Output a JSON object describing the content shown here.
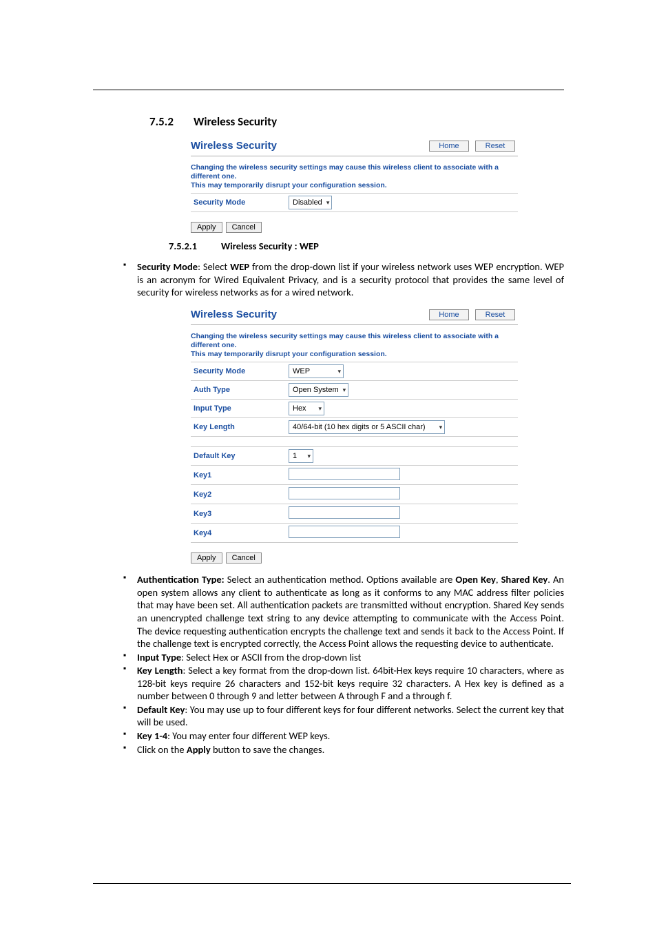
{
  "headings": {
    "section_num": "7.5.2",
    "section_title": "Wireless Security",
    "sub_num": "7.5.2.1",
    "sub_title": "Wireless Security : WEP"
  },
  "panel_common": {
    "title": "Wireless Security",
    "home_btn": "Home",
    "reset_btn": "Reset",
    "note_line1": "Changing the wireless security settings may cause this wireless client to associate with a different one.",
    "note_line2": "This may temporarily disrupt your configuration session.",
    "security_mode_label": "Security Mode",
    "apply_btn": "Apply",
    "cancel_btn": "Cancel"
  },
  "panel1": {
    "security_mode_value": "Disabled"
  },
  "panel2": {
    "security_mode_value": "WEP",
    "auth_type_label": "Auth Type",
    "auth_type_value": "Open System",
    "input_type_label": "Input Type",
    "input_type_value": "Hex",
    "key_length_label": "Key Length",
    "key_length_value": "40/64-bit (10 hex digits or 5 ASCII char)",
    "default_key_label": "Default Key",
    "default_key_value": "1",
    "key1_label": "Key1",
    "key2_label": "Key2",
    "key3_label": "Key3",
    "key4_label": "Key4"
  },
  "paragraphs": {
    "sec_mode": {
      "label": "Security Mode",
      "text_before": ": Select ",
      "bold2": "WEP",
      "text_after": " from the drop-down list if your wireless network uses WEP encryption. WEP is an acronym for Wired Equivalent Privacy, and is a security protocol that provides the same level of security for wireless networks as for a wired network."
    },
    "auth_type": {
      "label": "Authentication Type:",
      "text1": " Select an authentication method. Options available are ",
      "bold2": "Open Key",
      "text2": ", ",
      "bold3": "Shared Key",
      "text3": ". An open system allows any client to authenticate as long as it conforms to any MAC address filter policies that may have been set. All authentication packets are transmitted without encryption. Shared Key sends an unencrypted challenge text string to any device attempting to communicate with the Access Point. The device requesting authentication encrypts the challenge text and sends it back to the Access Point. If the challenge text is encrypted correctly, the Access Point allows the requesting device to authenticate."
    },
    "input_type": {
      "label": "Input Type",
      "text": ": Select Hex or ASCII from the drop-down list"
    },
    "key_length": {
      "label": "Key Length",
      "text": ": Select a key format from the drop-down list. 64bit-Hex keys require 10 characters, where as 128-bit keys require 26 characters and 152-bit keys require 32 characters. A Hex key is defined as a number between 0 through 9 and letter between A through F and a through f."
    },
    "default_key": {
      "label": "Default Key",
      "text": ": You may use up to four different keys for four different networks. Select the current key that will be used."
    },
    "key14": {
      "label": "Key 1-4",
      "text": ": You may enter four different WEP keys."
    },
    "apply_line": {
      "text1": "Click on the ",
      "bold": "Apply",
      "text2": " button to save the changes."
    }
  }
}
